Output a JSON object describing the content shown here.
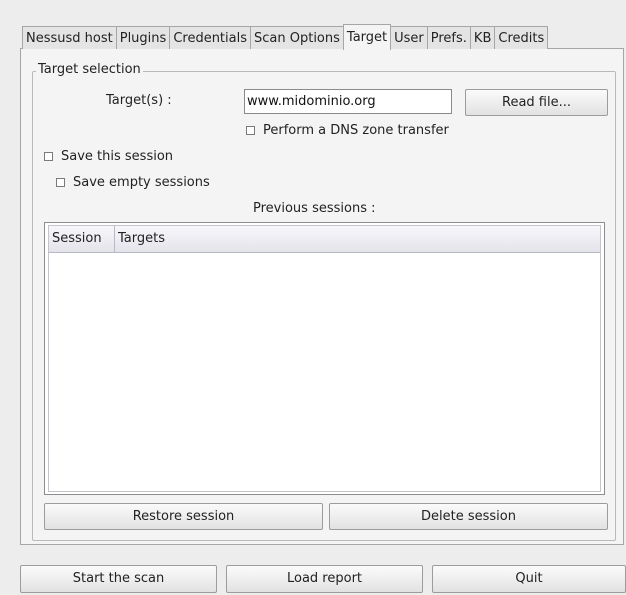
{
  "tabs": [
    {
      "label": "Nessusd host"
    },
    {
      "label": "Plugins"
    },
    {
      "label": "Credentials"
    },
    {
      "label": "Scan Options"
    },
    {
      "label": "Target",
      "active": true
    },
    {
      "label": "User"
    },
    {
      "label": "Prefs."
    },
    {
      "label": "KB"
    },
    {
      "label": "Credits"
    }
  ],
  "target": {
    "group_title": "Target selection",
    "targets_label": "Target(s) :",
    "targets_value": "www.midominio.org",
    "read_file_label": "Read file...",
    "dns_transfer_label": "Perform a DNS zone transfer",
    "dns_transfer_checked": false,
    "save_session_label": "Save this session",
    "save_session_checked": false,
    "save_empty_label": "Save empty sessions",
    "save_empty_checked": false,
    "previous_sessions_label": "Previous sessions :",
    "columns": [
      "Session",
      "Targets"
    ],
    "rows": [],
    "restore_label": "Restore session",
    "delete_label": "Delete session"
  },
  "footer": {
    "start_label": "Start the scan",
    "load_label": "Load report",
    "quit_label": "Quit"
  }
}
